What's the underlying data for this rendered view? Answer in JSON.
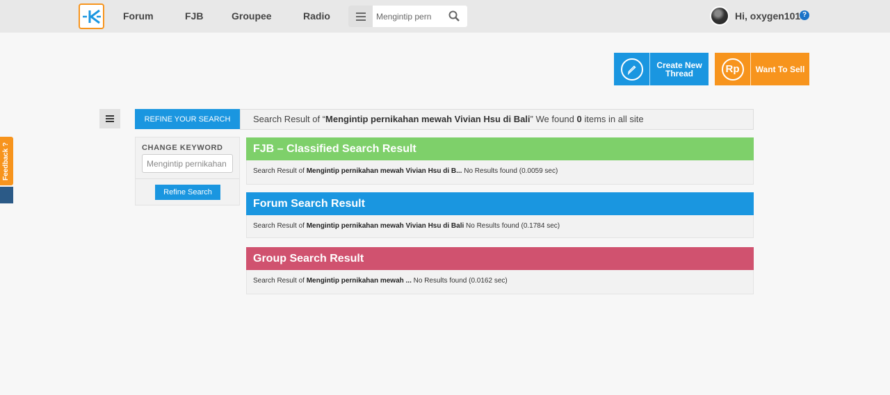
{
  "nav": {
    "logo_letter": "K",
    "links": [
      "Forum",
      "FJB",
      "Groupee",
      "Radio"
    ],
    "search_value": "Mengintip pern",
    "greeting": "Hi, oxygen101",
    "help_symbol": "?"
  },
  "actions": {
    "create_label": "Create New Thread",
    "sell_label": "Want To Sell",
    "sell_icon_text": "Rp"
  },
  "feedback": {
    "label": "Feedback ?"
  },
  "refine": {
    "tab_label": "REFINE YOUR SEARCH",
    "change_keyword_label": "CHANGE KEYWORD",
    "keyword_value": "Mengintip pernikahan mewah Vivian Hsu di Bali",
    "button_label": "Refine Search"
  },
  "summary": {
    "prefix": "Search Result of “",
    "query": "Mengintip pernikahan mewah Vivian Hsu di Bali",
    "middle": "” We found ",
    "count": "0",
    "suffix": " items in all site"
  },
  "sections": [
    {
      "title": "FJB – Classified Search Result",
      "color": "#7ed06a",
      "prefix": "Search Result of ",
      "query": "Mengintip pernikahan mewah Vivian Hsu di B...",
      "status": " No Results found (0.0059 sec)"
    },
    {
      "title": "Forum Search Result",
      "color": "#1a96e0",
      "prefix": "Search Result of ",
      "query": "Mengintip pernikahan mewah Vivian Hsu di Bali",
      "status": " No Results found (0.1784 sec)"
    },
    {
      "title": "Group Search Result",
      "color": "#d0526f",
      "prefix": "Search Result of ",
      "query": "Mengintip pernikahan mewah ...",
      "status": " No Results found (0.0162 sec)"
    }
  ],
  "colors": {
    "accent_blue": "#1a96e0",
    "accent_orange": "#f7941d"
  },
  "icons": [
    "kaskus-logo-icon",
    "menu-icon",
    "search-icon",
    "help-icon",
    "pencil-icon",
    "rupiah-icon",
    "hamburger-icon"
  ]
}
